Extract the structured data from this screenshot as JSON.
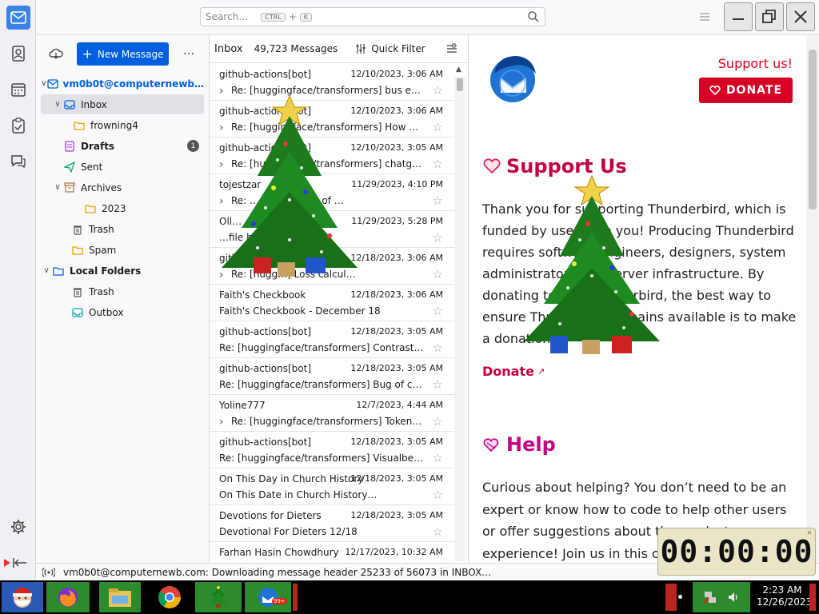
{
  "search": {
    "placeholder": "Search…",
    "kbd1": "CTRL",
    "plus": "+",
    "kbd2": "K"
  },
  "folder_pane": {
    "new_message_label": "New Message",
    "more_label": "…",
    "account": "vm0b0t@computernewb…",
    "items": [
      {
        "label": "Inbox",
        "icon": "inbox-icon"
      },
      {
        "label": "frowning4",
        "icon": "folder-icon"
      },
      {
        "label": "Drafts",
        "icon": "drafts-icon",
        "badge": "1"
      },
      {
        "label": "Sent",
        "icon": "sent-icon"
      },
      {
        "label": "Archives",
        "icon": "archive-icon"
      },
      {
        "label": "2023",
        "icon": "folder-icon"
      },
      {
        "label": "Trash",
        "icon": "trash-icon"
      },
      {
        "label": "Spam",
        "icon": "folder-icon"
      },
      {
        "label": "Local Folders",
        "icon": "local-folders-icon"
      },
      {
        "label": "Trash",
        "icon": "trash-icon"
      },
      {
        "label": "Outbox",
        "icon": "outbox-icon"
      }
    ]
  },
  "thread_pane": {
    "folder_name": "Inbox",
    "message_count": "49,723 Messages",
    "quick_filter_label": "Quick Filter",
    "messages": [
      {
        "sender": "github-actions[bot]",
        "date": "12/10/2023, 3:06 AM",
        "subject": "Re: [huggingface/transformers] bus err…"
      },
      {
        "sender": "github-actions[bot]",
        "date": "12/10/2023, 3:06 AM",
        "subject": "Re: [huggingface/transformers] How Ca…"
      },
      {
        "sender": "github-actions[bot]",
        "date": "12/10/2023, 3:05 AM",
        "subject": "Re: [huggingface/transformers] chatglm…"
      },
      {
        "sender": "tojestzar",
        "date": "11/29/2023, 4:10 PM",
        "subject": "Re: …on] The Last of …"
      },
      {
        "sender": "Oll…",
        "date": "11/29/2023, 5:28 PM",
        "subject": "…file had cha…"
      },
      {
        "sender": "github…",
        "date": "12/18/2023, 3:06 AM",
        "subject": "Re: [hugg…] Loss calcul…"
      },
      {
        "sender": "Faith's Checkbook",
        "date": "12/18/2023, 3:06 AM",
        "subject": "Faith's Checkbook - December 18"
      },
      {
        "sender": "github-actions[bot]",
        "date": "12/18/2023, 3:05 AM",
        "subject": "Re: [huggingface/transformers] Contrastiv…"
      },
      {
        "sender": "github-actions[bot]",
        "date": "12/18/2023, 3:05 AM",
        "subject": "Re: [huggingface/transformers] Bug of che…"
      },
      {
        "sender": "Yoline777",
        "date": "12/7/2023, 4:44 AM",
        "subject": "Re: [huggingface/transformers] Tokeniz…"
      },
      {
        "sender": "github-actions[bot]",
        "date": "12/18/2023, 3:05 AM",
        "subject": "Re: [huggingface/transformers] Visualbert …"
      },
      {
        "sender": "On This Day in Church History",
        "date": "12/18/2023, 3:05 AM",
        "subject": "On This Date in Church History…"
      },
      {
        "sender": "Devotions for Dieters",
        "date": "12/18/2023, 3:05 AM",
        "subject": "Devotional For Dieters 12/18"
      },
      {
        "sender": "Farhan Hasin Chowdhury",
        "date": "12/17/2023, 10:32 AM",
        "subject": ""
      }
    ]
  },
  "content": {
    "support_link": "Support us!",
    "donate_button": "DONATE",
    "support_heading": "Support Us",
    "support_body": "Thank you for supporting Thunderbird, which is funded by users like you! Producing Thunderbird requires software engineers, designers, system administrators and server infrastructure. By donating to the Thunderbird, the best way to ensure Thunderbird remains available is to make a donation.",
    "donate_link": "Donate",
    "help_heading": "Help",
    "help_body": "Curious about helping? You don’t need to be an expert or know how to code to help other users or offer suggestions about the products… experience! Join us in this c…"
  },
  "status_bar": {
    "text": "vm0b0t@computernewb.com: Downloading message header 25233 of 56073 in INBOX…"
  },
  "taskbar": {
    "time": "2:23 AM",
    "date": "12/26/2023",
    "chat_badge": "99+"
  },
  "timer": {
    "value": "00:00:00"
  },
  "colors": {
    "accent": "#0060df",
    "donate_red": "#d70022",
    "heading_red": "#c50042",
    "help_pink": "#c60084",
    "tree_green": "#1d7a1d"
  }
}
